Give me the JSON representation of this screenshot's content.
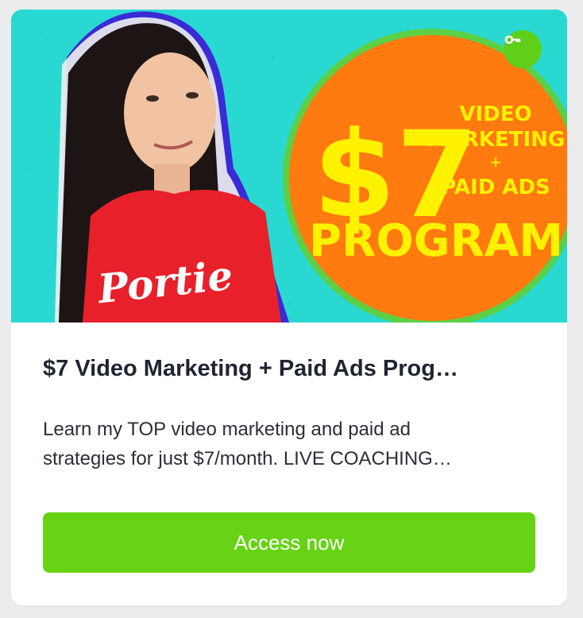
{
  "card": {
    "thumbnail": {
      "price_text": "$7",
      "headline_line1": "VIDEO",
      "headline_line2": "MARKETING",
      "plus": "+",
      "headline_line3": "PAID ADS",
      "program_text": "PROGRAM",
      "shirt_text": "Portie",
      "key_icon": "key-icon",
      "colors": {
        "background": "#2ad8d2",
        "circle": "#ff7a0f",
        "text": "#fff200",
        "shirt": "#e8202a",
        "badge": "#5fcf19"
      }
    },
    "title": "$7 Video Marketing + Paid Ads Prog…",
    "description_line1": "Learn my TOP video marketing and paid ad",
    "description_line2": "strategies for just $7/month. LIVE COACHING…",
    "button_label": "Access now",
    "button_color": "#66d314"
  }
}
